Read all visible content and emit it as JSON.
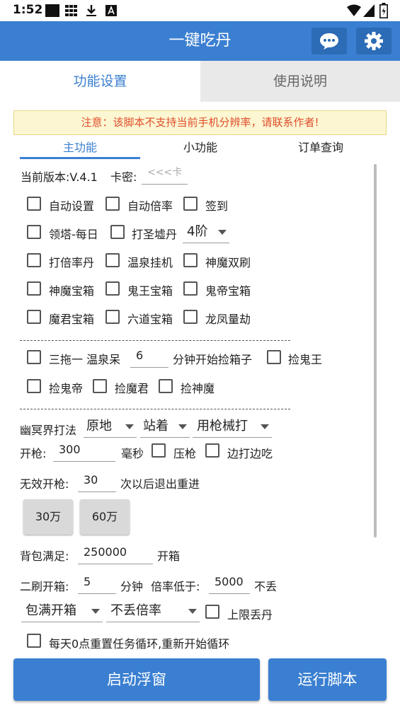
{
  "status_bar": {
    "time": "1:52"
  },
  "app": {
    "title": "一键吃丹"
  },
  "tabs": [
    "功能设置",
    "使用说明"
  ],
  "notice": "注意：该脚本不支持当前手机分辨率，请联系作者!",
  "subtabs": [
    "主功能",
    "小功能",
    "订单查询"
  ],
  "version": {
    "label": "当前版本:V.4.1",
    "card_label": "卡密:",
    "card_placeholder": "<<<卡"
  },
  "options_row1": [
    "自动设置",
    "自动倍率",
    "签到"
  ],
  "options_row2": {
    "tower": "领塔-每日",
    "furnace": "打圣墟丹",
    "level": "4阶"
  },
  "options_row3": [
    "打倍率丹",
    "温泉挂机",
    "神魔双刷"
  ],
  "options_row4": [
    "神魔宝箱",
    "鬼王宝箱",
    "鬼帝宝箱"
  ],
  "options_row5": [
    "魔君宝箱",
    "六道宝箱",
    "龙凤量劫"
  ],
  "hot_spring": {
    "label": "三拖一 温泉呆",
    "minutes": "6",
    "after": "分钟开始捡箱子",
    "pick_ghost_king": "捡鬼王"
  },
  "pick_row": [
    "捡鬼帝",
    "捡魔君",
    "捡神魔"
  ],
  "underworld": {
    "label": "幽冥界打法",
    "mode1": "原地",
    "mode2": "站着",
    "mode3": "用枪械打"
  },
  "fire": {
    "label": "开枪:",
    "value": "300",
    "unit": "毫秒",
    "press": "压枪",
    "move": "边打边吃"
  },
  "invalid_fire": {
    "label": "无效开枪:",
    "value": "30",
    "after": "次以后退出重进"
  },
  "quick_buttons": [
    "30万",
    "60万"
  ],
  "bag_full": {
    "label": "背包满足:",
    "value": "250000",
    "after": "开箱"
  },
  "second_pass": {
    "label": "二刷开箱:",
    "minutes": "5",
    "unit": "分钟",
    "rate_label": "倍率低于:",
    "rate_value": "5000",
    "discard": "不丢"
  },
  "bag_mode": {
    "select1": "包满开箱",
    "select2": "不丢倍率",
    "limit": "上限丢丹"
  },
  "daily_reset": "每天0点重置任务循环,重新开始循环",
  "actions": {
    "float": "启动浮窗",
    "run": "运行脚本"
  },
  "colors": {
    "primary": "#3a7fd1",
    "notice_text": "#e04d2c",
    "notice_bg": "#fcf7d2"
  }
}
